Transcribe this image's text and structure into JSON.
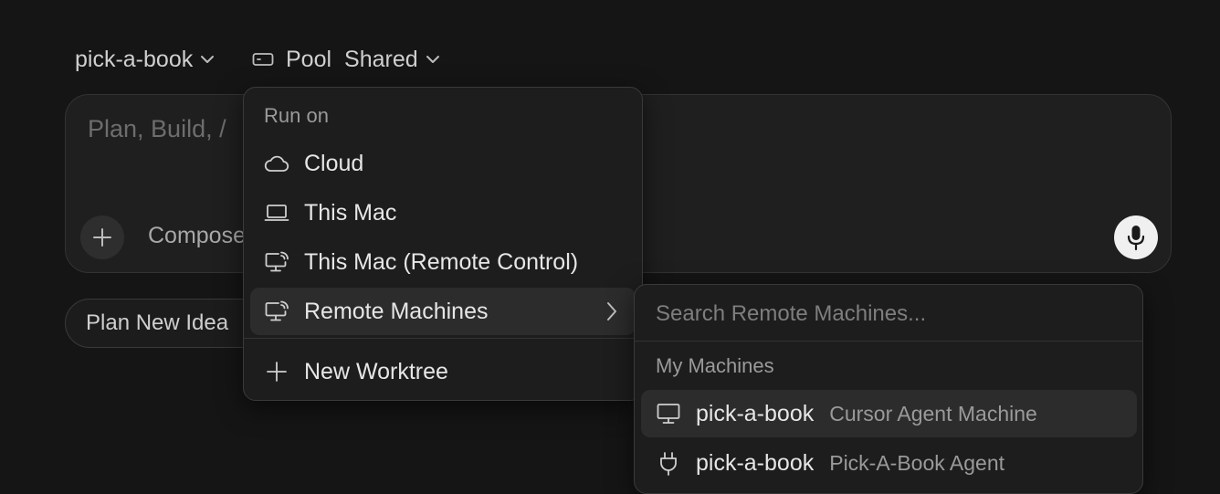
{
  "topbar": {
    "repo_label": "pick-a-book",
    "pool_label": "Pool",
    "pool_value": "Shared"
  },
  "composer": {
    "placeholder": "Plan, Build, /",
    "mode_label": "Compose"
  },
  "chips": {
    "plan_new_idea": "Plan New Idea"
  },
  "run_on_menu": {
    "header": "Run on",
    "items": [
      {
        "label": "Cloud",
        "icon": "cloud-icon"
      },
      {
        "label": "This Mac",
        "icon": "laptop-icon"
      },
      {
        "label": "This Mac (Remote Control)",
        "icon": "remote-desktop-icon"
      },
      {
        "label": "Remote Machines",
        "icon": "remote-desktop-icon"
      },
      {
        "label": "New Worktree",
        "icon": "plus-icon"
      }
    ]
  },
  "remote_machines": {
    "search_placeholder": "Search Remote Machines...",
    "section_header": "My Machines",
    "machines": [
      {
        "name": "pick-a-book",
        "description": "Cursor Agent Machine",
        "icon": "monitor-icon"
      },
      {
        "name": "pick-a-book",
        "description": "Pick-A-Book Agent",
        "icon": "plug-icon"
      }
    ]
  }
}
